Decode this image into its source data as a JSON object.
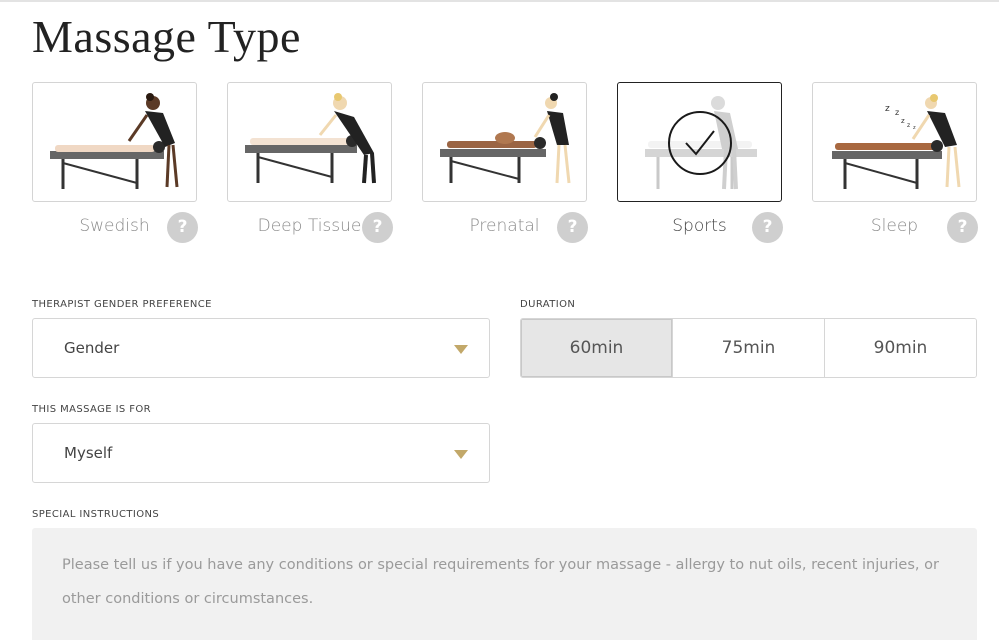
{
  "page": {
    "title": "Massage Type"
  },
  "massage_types": [
    {
      "label": "Swedish",
      "help": "?",
      "selected": false
    },
    {
      "label": "Deep Tissue",
      "help": "?",
      "selected": false
    },
    {
      "label": "Prenatal",
      "help": "?",
      "selected": false
    },
    {
      "label": "Sports",
      "help": "?",
      "selected": true
    },
    {
      "label": "Sleep",
      "help": "?",
      "selected": false
    }
  ],
  "gender": {
    "label": "THERAPIST GENDER PREFERENCE",
    "value": "Gender"
  },
  "duration": {
    "label": "DURATION",
    "options": [
      "60min",
      "75min",
      "90min"
    ],
    "selected": "60min"
  },
  "recipient": {
    "label": "THIS MASSAGE IS FOR",
    "value": "Myself"
  },
  "special": {
    "label": "SPECIAL INSTRUCTIONS",
    "placeholder": "Please tell us if you have any conditions or special requirements for your massage - allergy to nut oils, recent injuries, or other conditions or circumstances."
  },
  "colors": {
    "accent_caret": "#c2a869",
    "selected_border": "#222222",
    "help_bg": "#cfcfcf"
  }
}
